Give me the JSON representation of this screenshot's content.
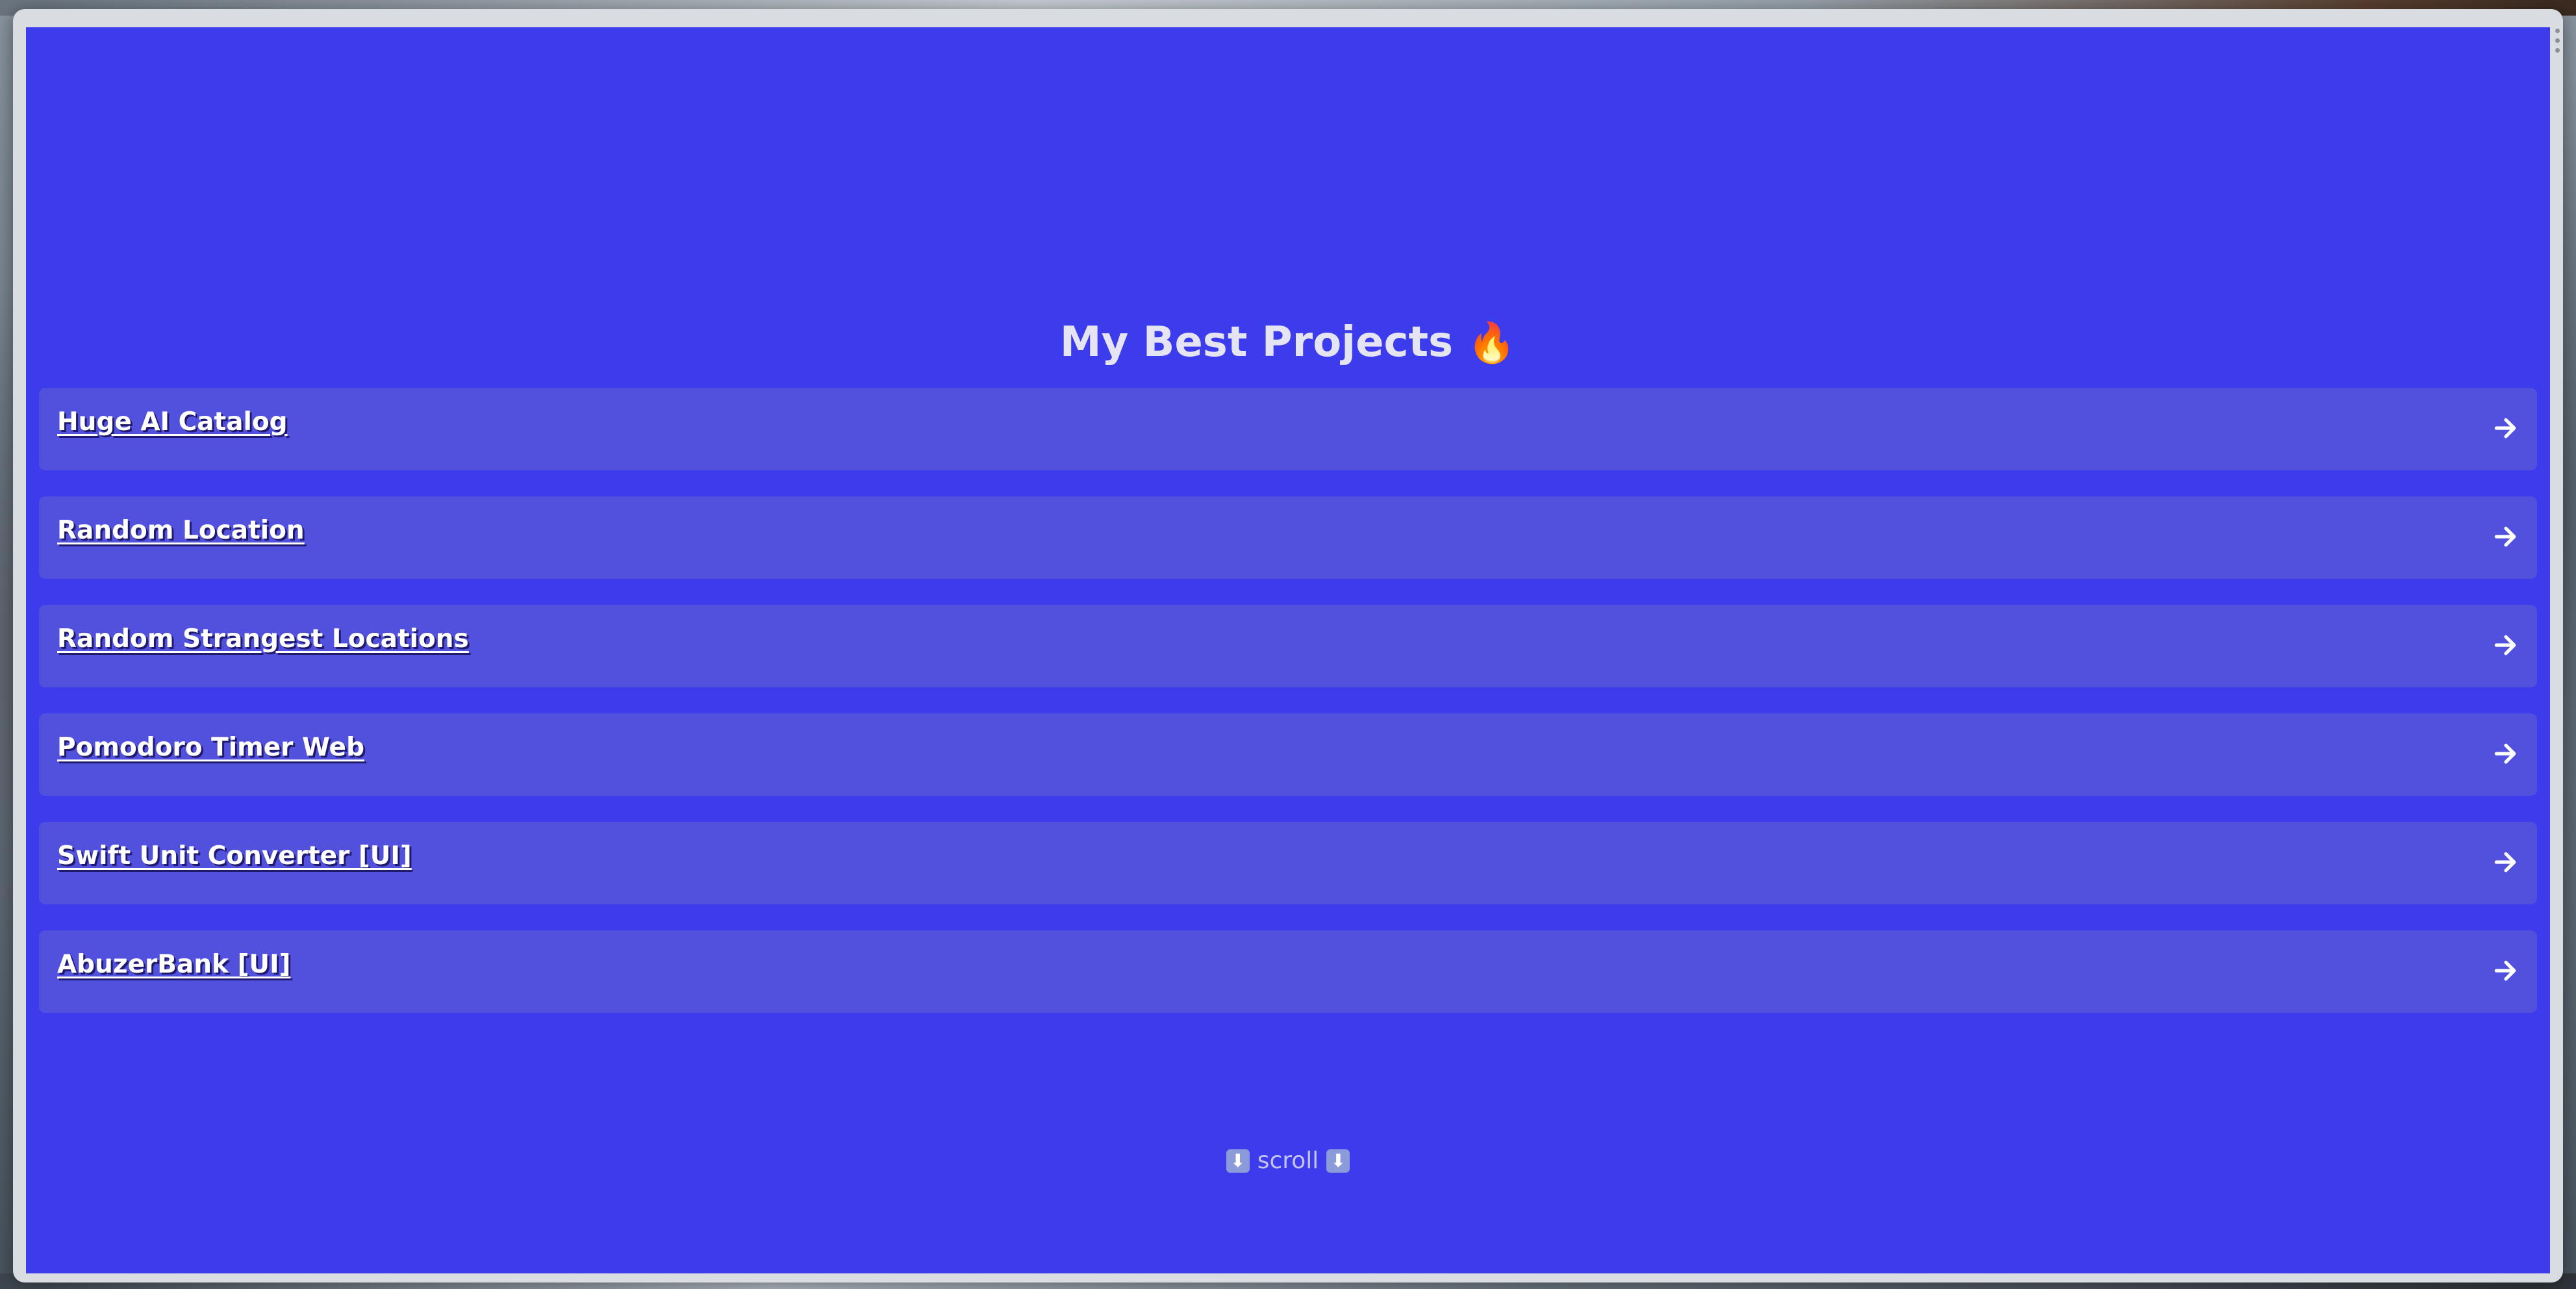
{
  "page": {
    "title": "My Best Projects",
    "title_emoji": "🔥",
    "scroll_hint": "scroll",
    "scroll_hint_icon": "⬇"
  },
  "projects": [
    {
      "label": "Huge AI Catalog",
      "icon": "arrow-right-icon"
    },
    {
      "label": "Random Location",
      "icon": "arrow-right-icon"
    },
    {
      "label": "Random Strangest Locations",
      "icon": "arrow-right-icon"
    },
    {
      "label": "Pomodoro Timer Web",
      "icon": "arrow-right-icon"
    },
    {
      "label": "Swift Unit Converter [UI]",
      "icon": "arrow-right-icon"
    },
    {
      "label": "AbuzerBank [UI]",
      "icon": "arrow-right-icon"
    }
  ],
  "colors": {
    "background": "#3d3ced",
    "card": "#5151de",
    "title_text": "#e5e4f2",
    "card_text": "#ffffff"
  }
}
